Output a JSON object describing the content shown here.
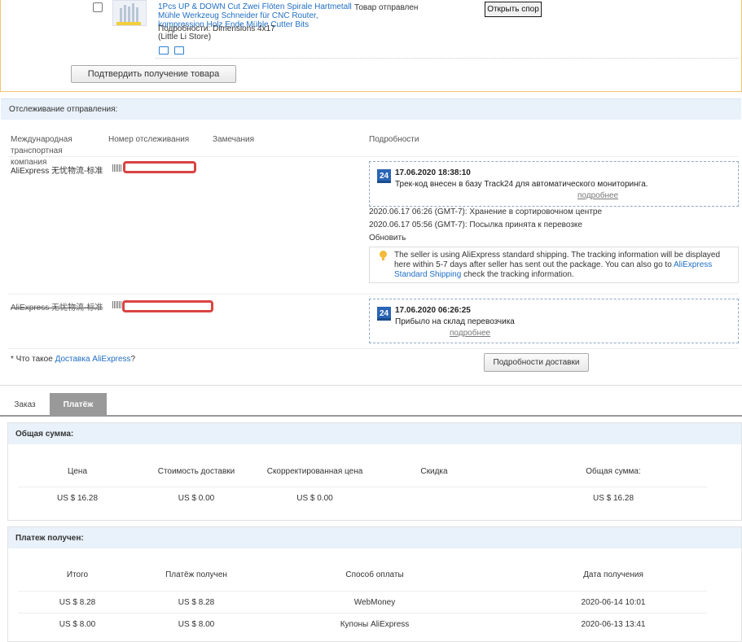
{
  "product": {
    "title": "1Pcs UP & DOWN Cut Zwei Flöten Spirale Hartmetall Mühle Werkzeug Schneider für CNC Router, kompression Holz Ende Mühle Cutter Bits",
    "details": "Подробности: Dimensions 4x17",
    "store": "(Little Li Store)",
    "status": "Товар отправлен",
    "dispute_button": "Открыть спор",
    "confirm_button": "Подтвердить получение товара"
  },
  "tracking": {
    "heading": "Отслеживание отправления:",
    "columns": {
      "carrier": "Международная транспортная компания",
      "number": "Номер отслеживания",
      "notes": "Замечания",
      "details": "Подробности"
    },
    "rows": [
      {
        "carrier": "AliExpress 无忧物流-标准",
        "badge": "24",
        "box_date": "17.06.2020 18:38:10",
        "box_text": "Трек-код внесен в базу Track24 для автоматического мониторинга.",
        "more": "подробнее",
        "events": [
          "2020.06.17 06:26 (GMT-7): Хранение в сортировочном центре",
          "2020.06.17 05:56 (GMT-7): Посылка принята к перевозке"
        ],
        "refresh": "Обновить",
        "info_pre": "The seller is using AliExpress standard shipping. The tracking information will be displayed here within 5-7 days after seller has sent out the package. You can also go to ",
        "info_link": "AliExpress Standard Shipping",
        "info_post": " check the tracking information."
      },
      {
        "carrier": "AliExpress 无忧物流-标准",
        "badge": "24",
        "box_date": "17.06.2020 06:26:25",
        "box_text": "Прибыло на склад перевозчика",
        "more": "подробнее"
      }
    ],
    "footnote_prefix": "* Что такое ",
    "footnote_link": "Доставка AliExpress",
    "footnote_suffix": "?",
    "delivery_button": "Подробности доставки"
  },
  "tabs": {
    "order": "Заказ",
    "payment": "Платёж"
  },
  "total": {
    "heading": "Общая сумма:",
    "headers": [
      "Цена",
      "Стоимость доставки",
      "Скорректированная цена",
      "Скидка",
      "Общая сумма:"
    ],
    "values": [
      "US $ 16.28",
      "US $ 0.00",
      "US $ 0.00",
      "",
      "US $ 16.28"
    ]
  },
  "payment": {
    "heading": "Платеж получен:",
    "headers": [
      "Итого",
      "Платёж получен",
      "Способ оплаты",
      "Дата получения"
    ],
    "rows": [
      [
        "US $ 8.28",
        "US $ 8.28",
        "WebMoney",
        "2020-06-14 10:01"
      ],
      [
        "US $ 8.00",
        "US $ 8.00",
        "Купоны AliExpress",
        "2020-06-13 13:41"
      ]
    ]
  }
}
